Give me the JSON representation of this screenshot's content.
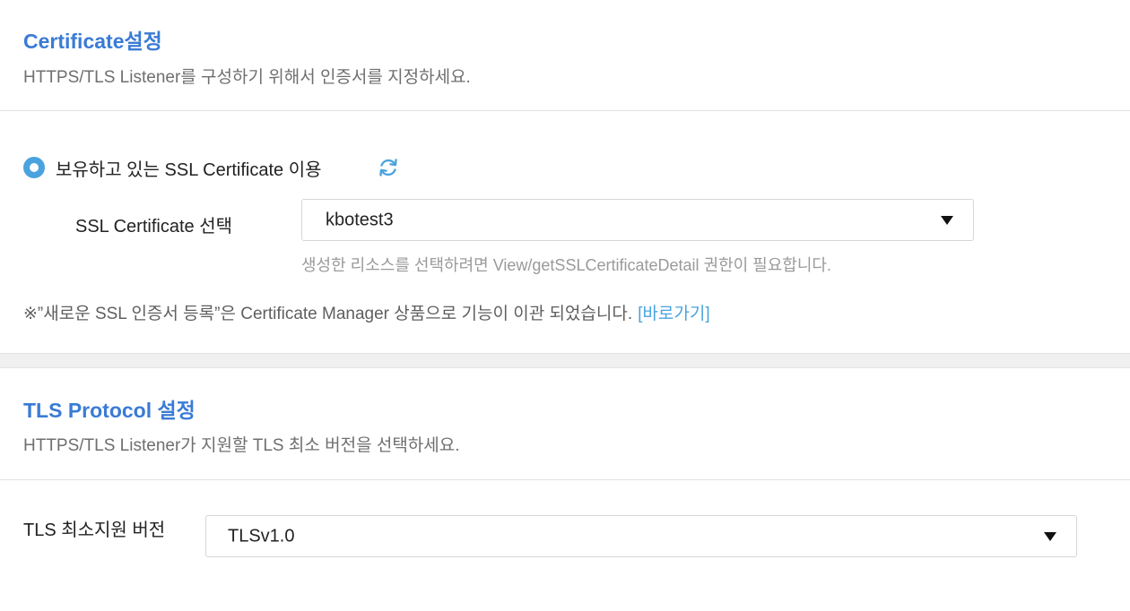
{
  "certificate_section": {
    "title": "Certificate설정",
    "description": "HTTPS/TLS Listener를 구성하기 위해서 인증서를 지정하세요.",
    "radio_label": "보유하고 있는 SSL Certificate 이용",
    "select_label": "SSL Certificate 선택",
    "selected_value": "kbotest3",
    "hint": "생성한 리소스를 선택하려면 View/getSSLCertificateDetail 권한이 필요합니다.",
    "notice_text": "※”새로운 SSL 인증서 등록”은 Certificate Manager 상품으로 기능이 이관 되었습니다.",
    "notice_link": "[바로가기]"
  },
  "tls_section": {
    "title": "TLS Protocol 설정",
    "description": "HTTPS/TLS Listener가 지원할 TLS 최소 버전을 선택하세요.",
    "select_label": "TLS 최소지원 버전",
    "selected_value": "TLSv1.0"
  },
  "icons": {
    "refresh": "refresh-icon",
    "caret": "caret-down-icon"
  },
  "colors": {
    "title": "#3a7bd5",
    "accent": "#4aa3df"
  }
}
